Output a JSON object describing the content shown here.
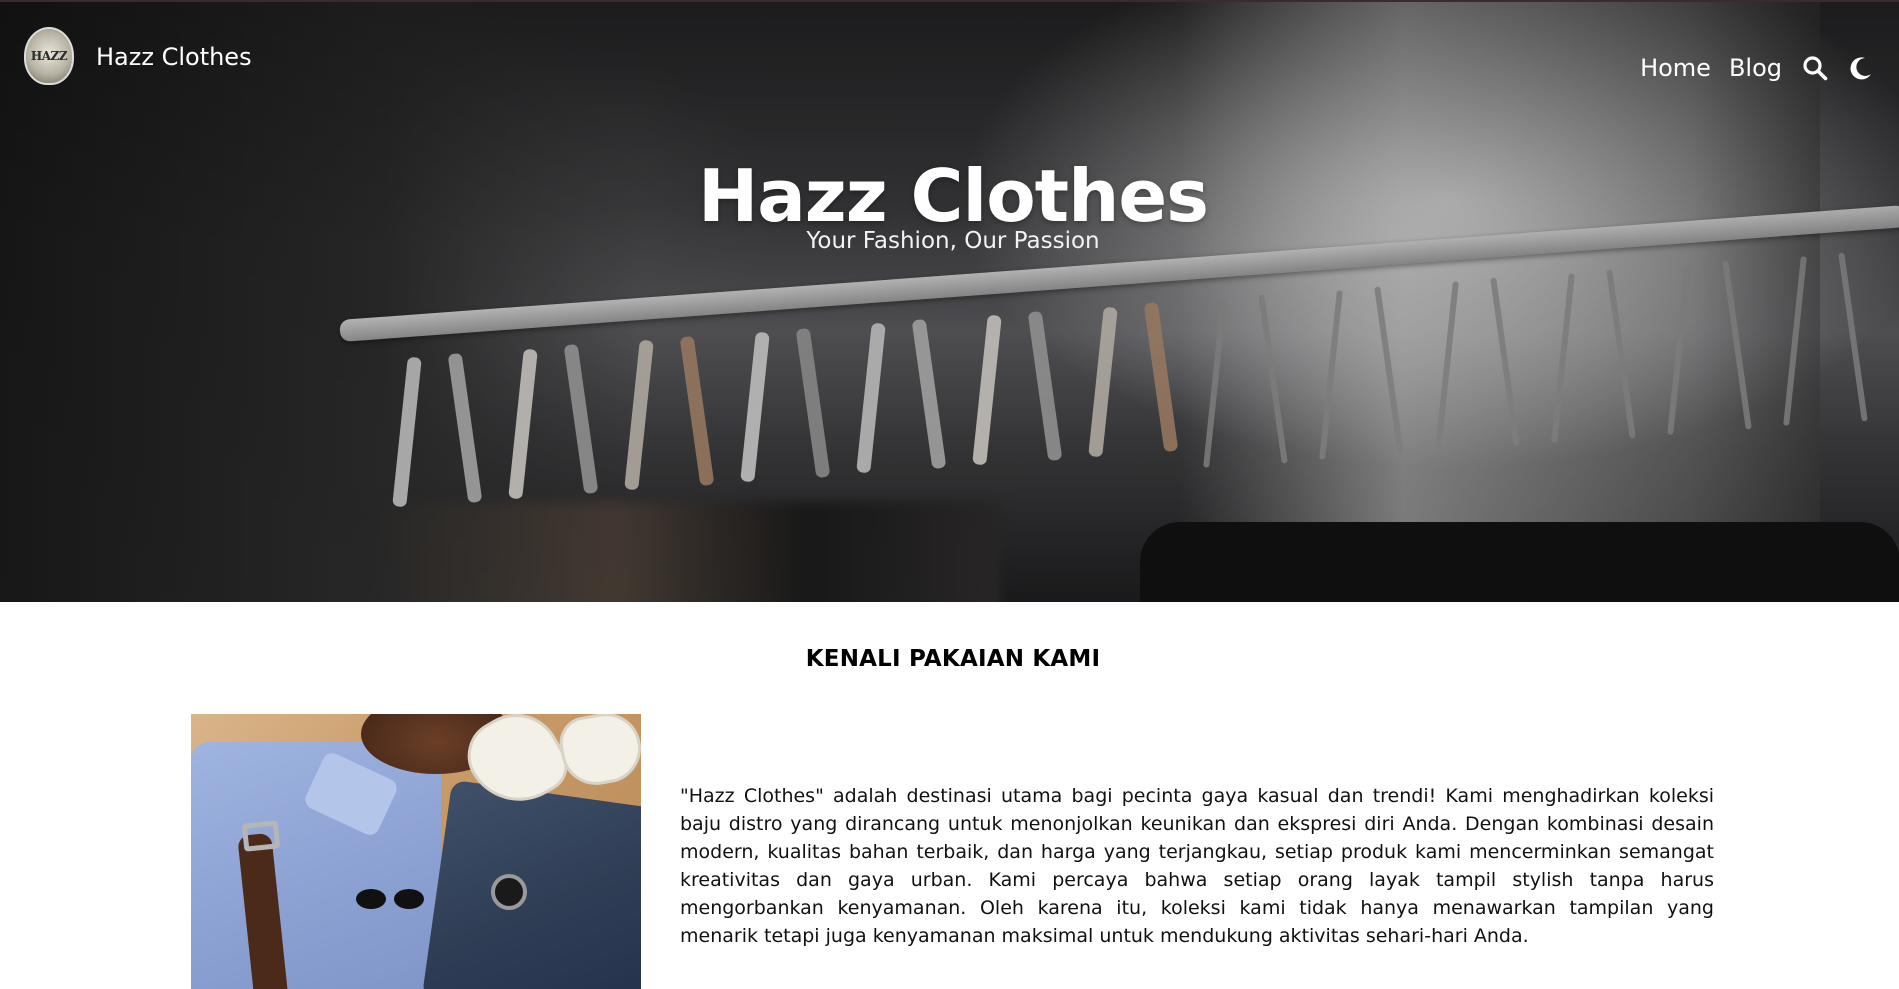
{
  "nav": {
    "brand_name": "Hazz Clothes",
    "logo_text": "HAZZ",
    "links": [
      "Home",
      "Blog"
    ],
    "search_icon": "search-icon",
    "theme_icon": "moon-icon"
  },
  "hero": {
    "title": "Hazz Clothes",
    "subtitle": "Your Fashion, Our Passion"
  },
  "about": {
    "heading": "KENALI PAKAIAN KAMI",
    "paragraph": "\"Hazz Clothes\" adalah destinasi utama bagi pecinta gaya kasual dan trendi! Kami menghadirkan koleksi baju distro yang dirancang untuk menonjolkan keunikan dan ekspresi diri Anda. Dengan kombinasi desain modern, kualitas bahan terbaik, dan harga yang terjangkau, setiap produk kami mencerminkan semangat kreativitas dan gaya urban. Kami percaya bahwa setiap orang layak tampil stylish tanpa harus mengorbankan kenyamanan. Oleh karena itu, koleksi kami tidak hanya menawarkan tampilan yang menarik tetapi juga kenyamanan maksimal untuk mendukung aktivitas sehari-hari Anda."
  },
  "colors": {
    "text_primary": "#000000",
    "nav_text": "#ffffff",
    "background": "#ffffff"
  }
}
